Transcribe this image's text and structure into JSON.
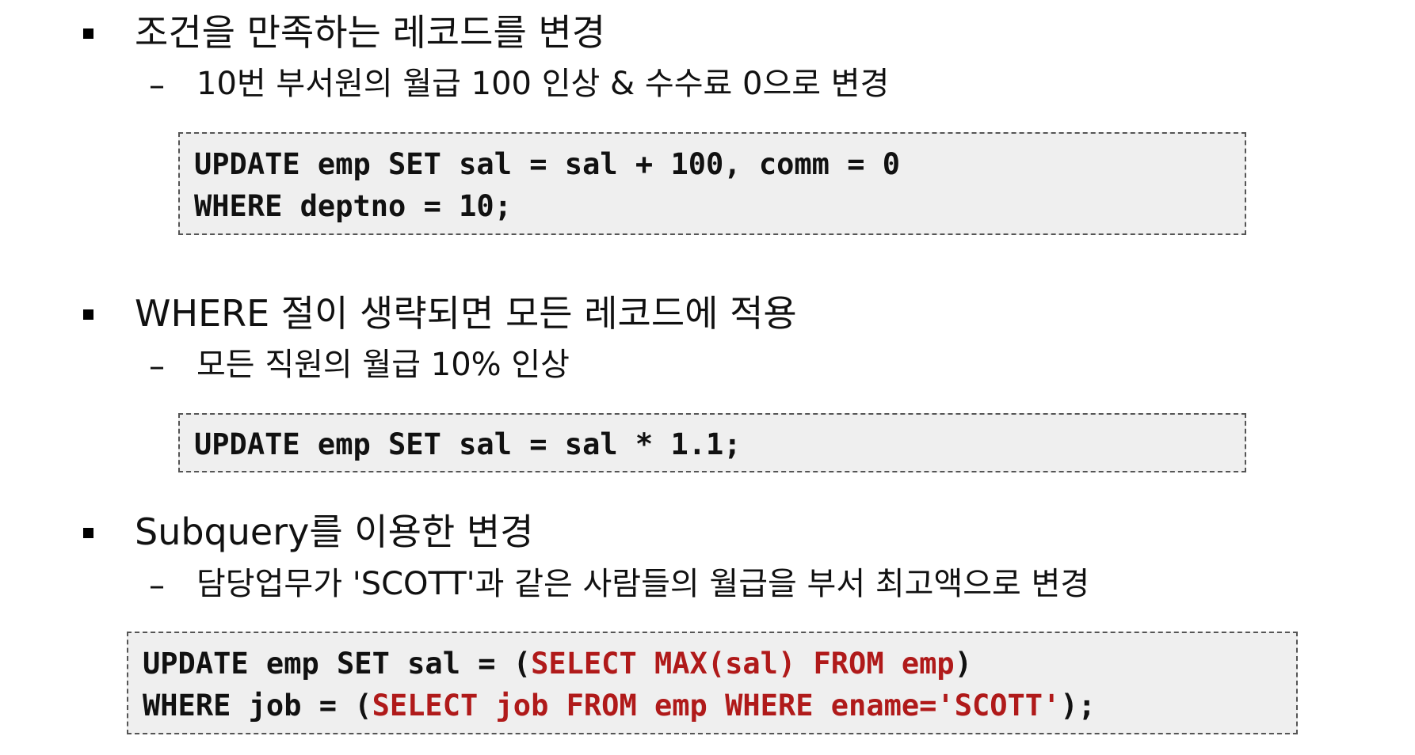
{
  "sections": [
    {
      "heading": "조건을 만족하는 레코드를 변경",
      "sub": "10번 부서원의 월급 100 인상 & 수수료 0으로 변경",
      "code": [
        "UPDATE emp SET sal = sal + 100, comm = 0",
        "WHERE deptno = 10;"
      ]
    },
    {
      "heading": "WHERE 절이 생략되면 모든 레코드에 적용",
      "sub": "모든 직원의 월급 10% 인상",
      "code": [
        "UPDATE emp SET sal = sal * 1.1;"
      ]
    },
    {
      "heading": "Subquery를 이용한 변경",
      "sub": "담당업무가 'SCOTT'과 같은 사람들의 월급을 부서 최고액으로 변경",
      "code_line1": {
        "plain_a": "UPDATE emp SET sal = (",
        "red_a": "SELECT MAX(sal) FROM emp",
        "plain_b": ")"
      },
      "code_line2": {
        "plain_a": "WHERE job = (",
        "red_a": "SELECT job FROM emp WHERE ename='SCOTT'",
        "plain_b": ");"
      }
    }
  ],
  "dash_symbol": "–",
  "colors": {
    "code_background": "#efefef",
    "code_border": "#555555",
    "subquery_keyword": "#b01a1a"
  }
}
